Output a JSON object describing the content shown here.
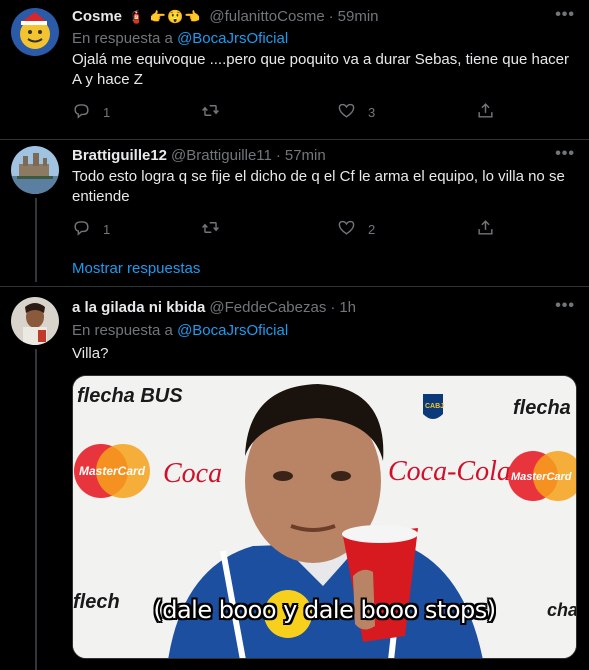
{
  "tweets": [
    {
      "name": "Cosme",
      "name_emoji": "🧯 👉😲👈",
      "handle": "@fulanittoCosme",
      "time": "59min",
      "reply_prefix": "En respuesta a",
      "reply_to": "@BocaJrsOficial",
      "text": "Ojalá  me equivoque ....pero que poquito va a durar Sebas,  tiene que hacer A y hace Z",
      "replies": "1",
      "retweets": "",
      "likes": "3"
    },
    {
      "name": "Brattiguille12",
      "handle": "@Brattiguille11",
      "time": "57min",
      "text": "Todo esto logra q se fije el dicho de q el Cf le arma el equipo, lo villa no se entiende",
      "replies": "1",
      "retweets": "",
      "likes": "2"
    },
    {
      "name": "a la gilada ni kbida",
      "handle": "@FeddeCabezas",
      "time": "1h",
      "reply_prefix": "En respuesta a",
      "reply_to": "@BocaJrsOficial",
      "text": "Villa?",
      "media_caption": "(dale booo y dale booo stops)"
    }
  ],
  "show_replies": "Mostrar respuestas",
  "more_label": "•••",
  "dot": "·",
  "media_backdrop": {
    "sponsor_top": "flecha BUS",
    "brand_left": "MasterCard",
    "brand_center": "Coca-Cola",
    "brand_right": "MasterCard",
    "club": "CABJ"
  },
  "colors": {
    "background": "#000000",
    "text": "#e7e9ea",
    "muted": "#71767b",
    "accent": "#1d9bf0",
    "divider": "#2f3336"
  }
}
